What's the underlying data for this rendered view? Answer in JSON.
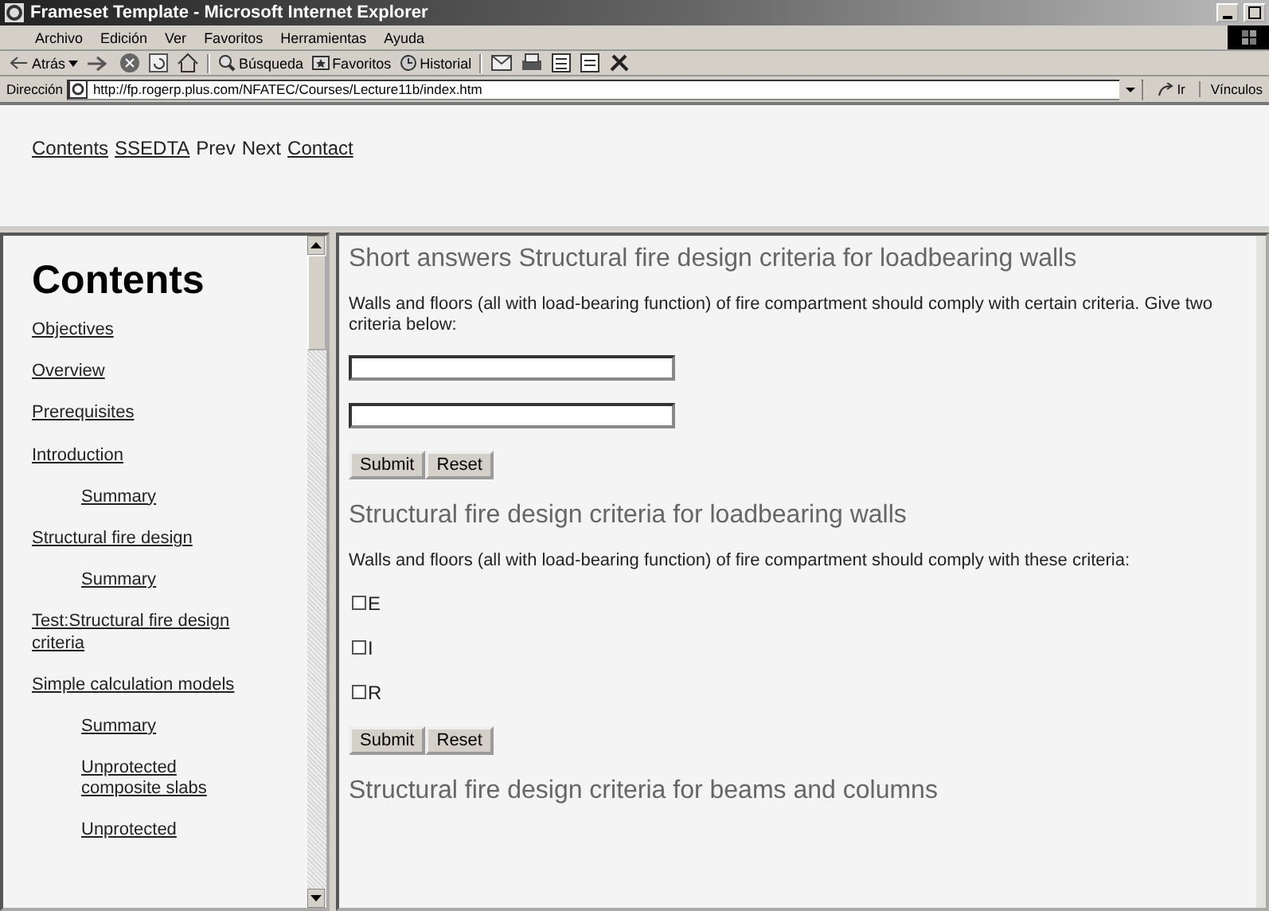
{
  "window": {
    "title": "Frameset Template - Microsoft Internet Explorer"
  },
  "menu": [
    "Archivo",
    "Edición",
    "Ver",
    "Favoritos",
    "Herramientas",
    "Ayuda"
  ],
  "toolbar": {
    "back": "Atrás",
    "search": "Búsqueda",
    "favorites": "Favoritos",
    "history": "Historial"
  },
  "address": {
    "label": "Dirección",
    "url": "http://fp.rogerp.plus.com/NFATEC/Courses/Lecture11b/index.htm",
    "go": "Ir",
    "links": "Vínculos"
  },
  "top_nav": [
    {
      "label": "Contents",
      "link": true
    },
    {
      "label": "SSEDTA",
      "link": true
    },
    {
      "label": "Prev",
      "link": false
    },
    {
      "label": "Next",
      "link": false
    },
    {
      "label": "Contact",
      "link": true
    }
  ],
  "sidebar": {
    "title": "Contents",
    "items": [
      {
        "label": "Objectives"
      },
      {
        "label": "Overview"
      },
      {
        "label": "Prerequisites"
      },
      {
        "label": "Introduction",
        "children": [
          {
            "label": "Summary"
          }
        ]
      },
      {
        "label": "Structural fire design",
        "children": [
          {
            "label": "Summary"
          }
        ]
      },
      {
        "label": "Test:Structural fire design criteria"
      },
      {
        "label": "Simple calculation models",
        "children": [
          {
            "label": "Summary"
          },
          {
            "label": "Unprotected composite slabs"
          },
          {
            "label": "Unprotected"
          }
        ]
      }
    ]
  },
  "sections": [
    {
      "kind": "text_answers",
      "heading": "Short answers Structural fire design criteria for loadbearing walls",
      "question": "Walls and floors (all with load-bearing function) of fire compartment should comply with certain criteria. Give two criteria below:",
      "buttons": [
        "Submit",
        "Reset"
      ]
    },
    {
      "kind": "checkboxes",
      "heading": "Structural fire design criteria for loadbearing walls",
      "question": "Walls and floors (all with load-bearing function) of fire compartment should comply with these criteria:",
      "options": [
        {
          "label": "E",
          "checked": false
        },
        {
          "label": "I",
          "checked": false
        },
        {
          "label": "R",
          "checked": false
        }
      ],
      "buttons": [
        "Submit",
        "Reset"
      ]
    },
    {
      "kind": "heading_only",
      "heading": "Structural fire design criteria for beams and columns"
    }
  ]
}
